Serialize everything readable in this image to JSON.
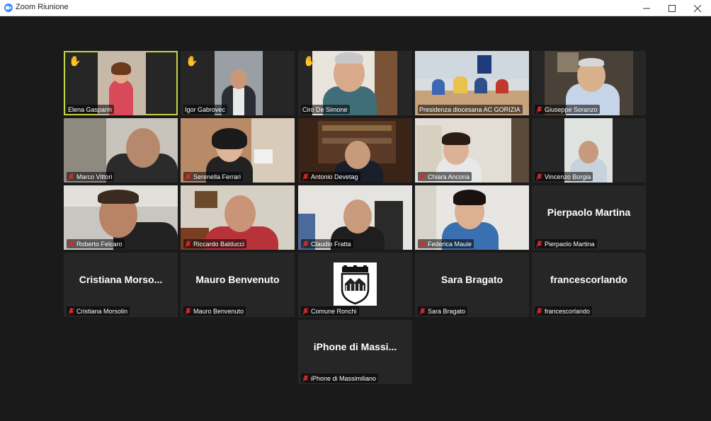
{
  "window": {
    "title": "Zoom Riunione"
  },
  "participants": [
    {
      "name": "Elena Gasparin",
      "hand": true,
      "muted": false
    },
    {
      "name": "Igor Gabrovec",
      "hand": true,
      "muted": false
    },
    {
      "name": "Ciro De Simone",
      "hand": true,
      "muted": false
    },
    {
      "name": "Presidenza diocesana AC GORIZIA",
      "hand": false,
      "muted": false
    },
    {
      "name": "Giuseppe Soranzo",
      "hand": false,
      "muted": true
    },
    {
      "name": "Marco Vittori",
      "hand": false,
      "muted": true
    },
    {
      "name": "Serenella Ferrari",
      "hand": false,
      "muted": true
    },
    {
      "name": "Antonio Devetag",
      "hand": false,
      "muted": true
    },
    {
      "name": "Chiara Ancona",
      "hand": false,
      "muted": true
    },
    {
      "name": "Vincenzo Borgia",
      "hand": false,
      "muted": true
    },
    {
      "name": "Roberto Felcaro",
      "hand": false,
      "muted": true
    },
    {
      "name": "Riccardo Balducci",
      "hand": false,
      "muted": true
    },
    {
      "name": "Claudio Fratta",
      "hand": false,
      "muted": true
    },
    {
      "name": "Federica Maule",
      "hand": false,
      "muted": true
    },
    {
      "name": "Pierpaolo Martina",
      "hand": false,
      "muted": true,
      "display": "Pierpaolo Martina"
    },
    {
      "name": "Cristiana Morsolin",
      "hand": false,
      "muted": true,
      "display": "Cristiana  Morso..."
    },
    {
      "name": "Mauro Benvenuto",
      "hand": false,
      "muted": true,
      "display": "Mauro Benvenuto"
    },
    {
      "name": "Comune Ronchi",
      "hand": false,
      "muted": true
    },
    {
      "name": "Sara Bragato",
      "hand": false,
      "muted": true,
      "display": "Sara Bragato"
    },
    {
      "name": "francescorlando",
      "hand": false,
      "muted": true,
      "display": "francescorlando"
    },
    {
      "name": "iPhone di Massimiliano",
      "hand": false,
      "muted": true,
      "display": "iPhone  di  Massi..."
    }
  ],
  "colors": {
    "active_speaker": "#c4d545",
    "muted_mic": "#e02828",
    "hand": "#f5c518"
  }
}
